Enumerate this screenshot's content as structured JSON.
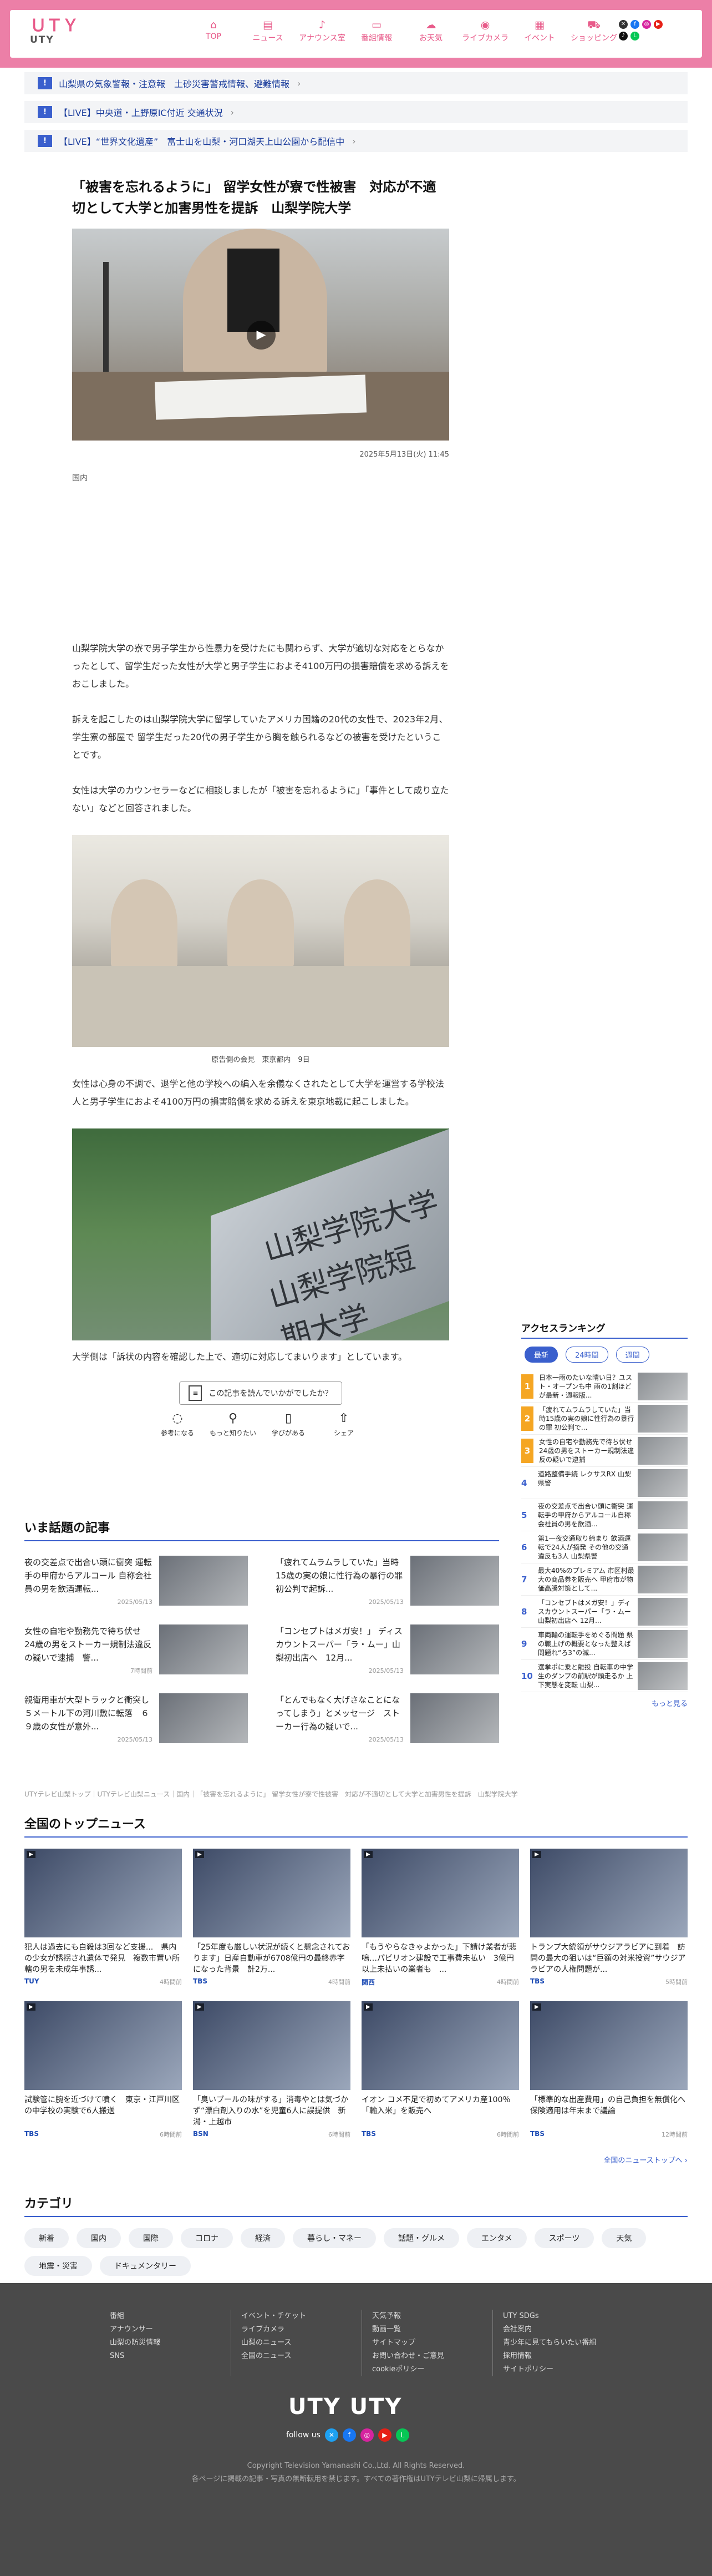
{
  "header": {
    "logo_main": "UTY",
    "logo_kana": "ＵＴＹ",
    "logo_sub": "UTY",
    "nav": [
      {
        "label": "TOP",
        "icon": "⌂"
      },
      {
        "label": "ニュース",
        "icon": "▤"
      },
      {
        "label": "アナウンス室",
        "icon": "♪"
      },
      {
        "label": "番組情報",
        "icon": "▭"
      },
      {
        "label": "お天気",
        "icon": "☁"
      },
      {
        "label": "ライブカメラ",
        "icon": "◉"
      },
      {
        "label": "イベント",
        "icon": "▦"
      },
      {
        "label": "ショッピング",
        "icon": "⛟"
      }
    ],
    "socials": [
      {
        "name": "x",
        "icon": "✕",
        "color": "#333333"
      },
      {
        "name": "facebook",
        "icon": "f",
        "color": "#1877f2"
      },
      {
        "name": "instagram",
        "icon": "◎",
        "color": "#d6249f"
      },
      {
        "name": "youtube",
        "icon": "▶",
        "color": "#e62117"
      },
      {
        "name": "tiktok",
        "icon": "♪",
        "color": "#111111"
      },
      {
        "name": "line",
        "icon": "L",
        "color": "#06c755"
      }
    ]
  },
  "alerts": [
    {
      "badge": "!",
      "text": "山梨県の気象警報・注意報　土砂災害警戒情報、避難情報"
    },
    {
      "badge": "!",
      "text": "【LIVE】中央道・上野原IC付近 交通状況"
    },
    {
      "badge": "!",
      "text": "【LIVE】“世界文化遺産”　富士山を山梨・河口湖天上山公園から配信中"
    }
  ],
  "article": {
    "title": "「被害を忘れるように」 留学女性が寮で性被害　対応が不適切として大学と加害男性を提訴　山梨学院大学",
    "date": "2025年5月13日(火) 11:45",
    "category": "国内",
    "paragraphs": [
      "山梨学院大学の寮で男子学生から性暴力を受けたにも関わらず、大学が適切な対応をとらなかったとして、留学生だった女性が大学と男子学生におよそ4100万円の損害賠償を求める訴えをおこしました。",
      "訴えを起こしたのは山梨学院大学に留学していたアメリカ国籍の20代の女性で、2023年2月、学生寮の部屋で 留学生だった20代の男子学生から胸を触られるなどの被害を受けたということです。",
      "女性は大学のカウンセラーなどに相談しましたが「被害を忘れるように」「事件として成り立たない」などと回答されました。"
    ],
    "caption": "原告側の会見　東京都内　9日",
    "para4": "女性は心身の不調で、退学と他の学校への編入を余儀なくされたとして大学を運営する学校法人と男子学生におよそ4100万円の損害賠償を求める訴えを東京地裁に起こしました。",
    "sign1": "山梨学院大学",
    "sign2": "山梨学院短期大学",
    "para5": "大学側は「訴状の内容を確認した上で、適切に対応してまいります」としています。",
    "feedback_question": "この記事を読んでいかがでしたか？",
    "reactions": [
      {
        "icon": "◌",
        "label": "参考になる"
      },
      {
        "icon": "⚲",
        "label": "もっと知りたい"
      },
      {
        "icon": "▯",
        "label": "学びがある"
      },
      {
        "icon": "⇧",
        "label": "シェア"
      }
    ]
  },
  "ranking": {
    "heading": "アクセスランキング",
    "tabs": [
      "最新",
      "24時間",
      "週間"
    ],
    "items": [
      {
        "rank": "1",
        "text": "日本一雨のたいな晴い日？ユスト・オープンも中 雨の1割ほどが最新・週報版..."
      },
      {
        "rank": "2",
        "text": "「疲れてムラムラしていた」当時15歳の実の娘に性行為の暴行の罪 初公判で..."
      },
      {
        "rank": "3",
        "text": "女性の自宅や勤務先で待ち伏せ 24歳の男をストーカー規制法違反の疑いで逮捕"
      },
      {
        "rank": "4",
        "text": "道路整備手続 レクサスRX 山梨県警"
      },
      {
        "rank": "5",
        "text": "夜の交差点で出合い頭に衝突 運転手の甲府からアルコール自称会社員の男を飲酒..."
      },
      {
        "rank": "6",
        "text": "第1一夜交通取り締まり 飲酒運転で24人が摘発 その他の交通違反も3人 山梨県警"
      },
      {
        "rank": "7",
        "text": "最大40%のプレミアム 市区村最大の商品券を販売へ 甲府市が物価高騰対策として..."
      },
      {
        "rank": "8",
        "text": "「コンセプトはメガ安！」ディスカウントスーパー「ラ・ムー山梨初出店へ 12月..."
      },
      {
        "rank": "9",
        "text": "車両輸の運転手をめぐる問題 県の職上げの概要となった整えば問題れ“ろ3”の減..."
      },
      {
        "rank": "10",
        "text": "選挙ポに乗と離投 自転車の中学生のダンプの前駅が頭走るか 上下実態を変転 山梨..."
      }
    ],
    "more": "もっと見る"
  },
  "wadai": {
    "heading": "いま話題の記事",
    "items": [
      {
        "text": "夜の交差点で出合い頭に衝突 運転手の甲府からアルコール 自称会社員の男を飲酒運転...",
        "date": "2025/05/13"
      },
      {
        "text": "「疲れてムラムラしていた」当時15歳の実の娘に性行為の暴行の罪　初公判で起訴...",
        "date": "2025/05/13"
      },
      {
        "text": "女性の自宅や勤務先で待ち伏せ　24歳の男をストーカー規制法違反の疑いで逮捕　警...",
        "date": "7時間前"
      },
      {
        "text": "「コンセプトはメガ安！」 ディスカウントスーパー「ラ・ムー」山梨初出店へ　12月...",
        "date": "2025/05/13"
      },
      {
        "text": "親衛用車が大型トラックと衝突し５メートル下の河川敷に転落　６９歳の女性が意外...",
        "date": "2025/05/13"
      },
      {
        "text": "「とんでもなく大げさなことになってしまう」とメッセージ　ストーカー行為の疑いで...",
        "date": "2025/05/13"
      }
    ]
  },
  "breadcrumb": "UTYテレビ山梨トップ｜UTYテレビ山梨ニュース｜国内｜「被害を忘れるように」 留学女性が寮で性被害　対応が不適切として大学と加害男性を提訴　山梨学院大学",
  "zenkoku": {
    "heading": "全国のトップニュース",
    "items": [
      {
        "text": "犯人は過去にも自殺は3回など支援...　県内の少女が誘拐され遺体で発見　複数市置い所轄の男を未成年事誘...",
        "source": "TUY",
        "time": "4時間前"
      },
      {
        "text": "「25年度も厳しい状況が続くと懸念されております」日産自動車が6708億円の最終赤字になった背景　計2万...",
        "source": "TBS",
        "time": "4時間前"
      },
      {
        "text": "「もうやらなきゃよかった」下請け業者が悲鳴…パビリオン建設で工事費未払い　3億円以上未払いの業者も　...",
        "source": "関西",
        "time": "4時間前"
      },
      {
        "text": "トランプ大統領がサウジアラビアに到着　訪問の最大の狙いは“巨額の対米投資”サウジアラビアの人権問題が...",
        "source": "TBS",
        "time": "5時間前"
      },
      {
        "text": "試験管に腕を近づけて噴く　東京・江戸川区の中学校の実験で6人搬送",
        "source": "TBS",
        "time": "6時間前"
      },
      {
        "text": "「臭いプールの味がする」消毒やとは気づかず“漂白剤入りの水”を児童6人に誤提供　新潟・上越市",
        "source": "BSN",
        "time": "6時間前"
      },
      {
        "text": "イオン コメ不足で初めてアメリカ産100％「輸入米」を販売へ",
        "source": "TBS",
        "time": "6時間前"
      },
      {
        "text": "「標準的な出産費用」の自己負担を無償化へ　保険適用は年末まで議論",
        "source": "TBS",
        "time": "12時間前"
      }
    ],
    "more": "全国のニューストップへ ›"
  },
  "category": {
    "heading": "カテゴリ",
    "chips": [
      "新着",
      "国内",
      "国際",
      "コロナ",
      "経済",
      "暮らし・マネー",
      "話題・グルメ",
      "エンタメ",
      "スポーツ",
      "天気",
      "地震・災害",
      "ドキュメンタリー"
    ]
  },
  "footer": {
    "columns": [
      [
        "番組",
        "アナウンサー",
        "山梨の防災情報",
        "SNS"
      ],
      [
        "イベント・チケット",
        "ライブカメラ",
        "山梨のニュース",
        "全国のニュース"
      ],
      [
        "天気予報",
        "動画一覧",
        "サイトマップ",
        "お問い合わせ・ご意見",
        "cookieポリシー"
      ],
      [
        "UTY SDGs",
        "会社案内",
        "青少年に見てもらいたい番組",
        "採用情報",
        "サイトポリシー"
      ]
    ],
    "logo": "UTY UTY",
    "follow": "follow us",
    "copyright": "Copyright Television Yamanashi Co.,Ltd. All Rights Reserved.",
    "note": "各ページに掲載の記事・写真の無断転用を禁じます。すべての著作権はUTYテレビ山梨に帰属します。"
  }
}
